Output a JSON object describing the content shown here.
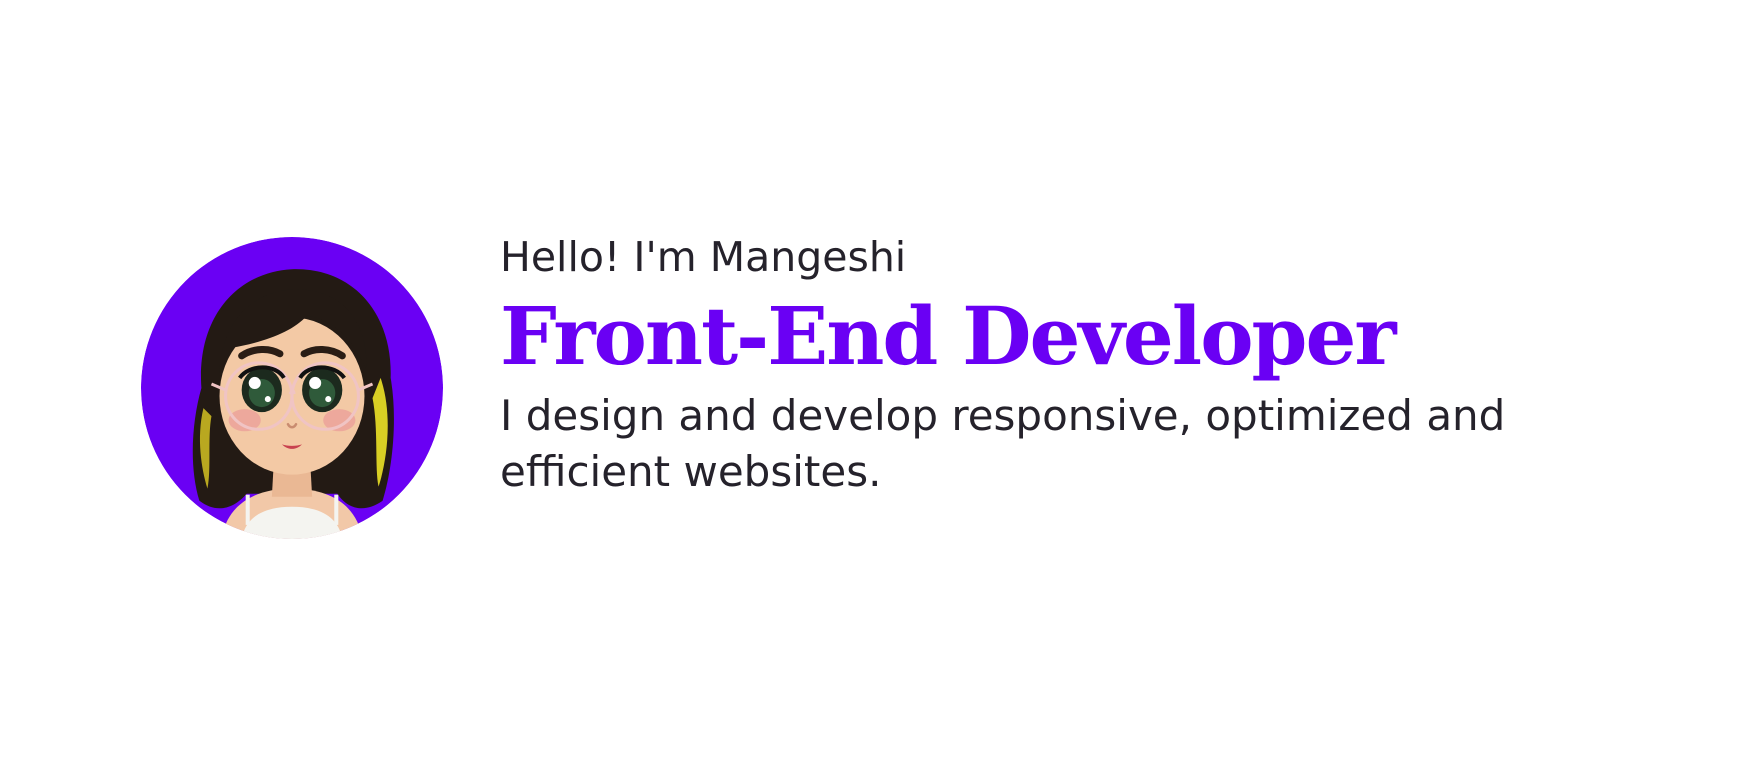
{
  "colors": {
    "accent": "#6a00f4",
    "text": "#25222b",
    "background": "#ffffff"
  },
  "hero": {
    "greeting": "Hello! I'm Mangeshi",
    "title": "Front-End Developer",
    "tagline": "I design and develop responsive, optimized and efficient websites.",
    "avatar_icon": "cartoon-girl-avatar"
  }
}
